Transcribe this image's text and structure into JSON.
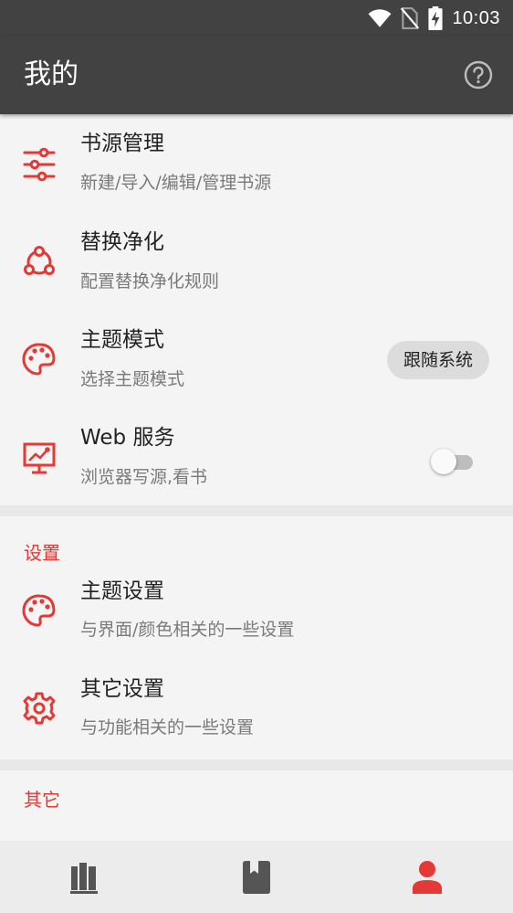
{
  "status_bar": {
    "time": "10:03",
    "icons": [
      "wifi-icon",
      "no-sim-icon",
      "battery-charging-icon"
    ]
  },
  "app_bar": {
    "title": "我的",
    "help_icon": "help-circle-icon"
  },
  "colors": {
    "accent": "#e53935",
    "bar": "#424242",
    "background": "#f2f2f2"
  },
  "main_items": [
    {
      "icon": "tune-sliders-icon",
      "title": "书源管理",
      "subtitle": "新建/导入/编辑/管理书源"
    },
    {
      "icon": "replace-icon",
      "title": "替换净化",
      "subtitle": "配置替换净化规则"
    },
    {
      "icon": "palette-icon",
      "title": "主题模式",
      "subtitle": "选择主题模式",
      "value": "跟随系统"
    },
    {
      "icon": "web-service-icon",
      "title": "Web 服务",
      "subtitle": "浏览器写源,看书",
      "toggle": false
    }
  ],
  "settings_section": {
    "header": "设置",
    "items": [
      {
        "icon": "palette-icon",
        "title": "主题设置",
        "subtitle": "与界面/颜色相关的一些设置"
      },
      {
        "icon": "gear-icon",
        "title": "其它设置",
        "subtitle": "与功能相关的一些设置"
      }
    ]
  },
  "other_section": {
    "header": "其它"
  },
  "bottom_nav": [
    {
      "icon": "bookshelf-icon",
      "active": false
    },
    {
      "icon": "book-bookmark-icon",
      "active": false
    },
    {
      "icon": "person-icon",
      "active": true
    }
  ]
}
